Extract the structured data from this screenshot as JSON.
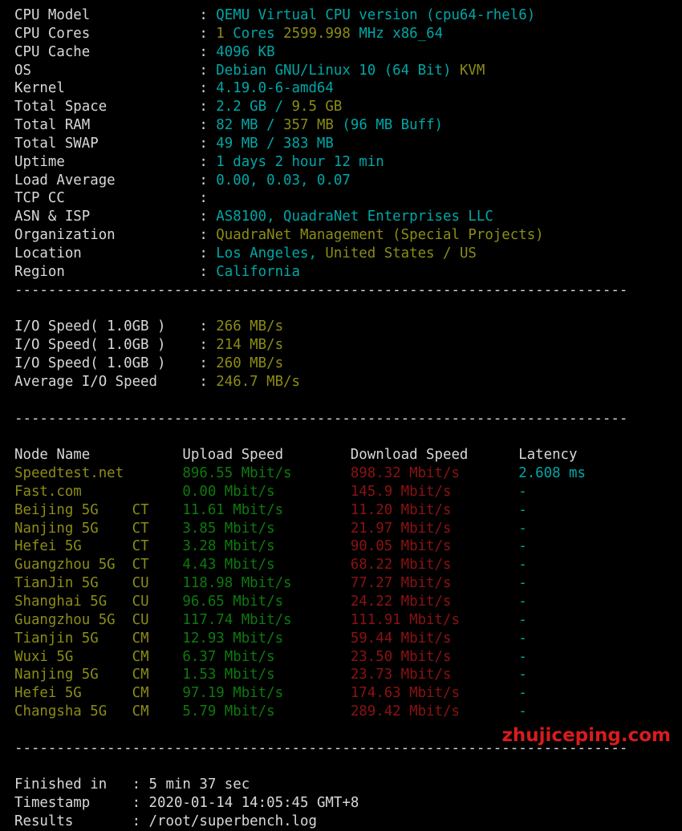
{
  "terminal": {
    "background_color": "#000000",
    "label_color": "#d8d8d8",
    "cyan": "#00a7a7",
    "olive": "#8c8c16",
    "green": "#0d7a0d",
    "red": "#8c1212",
    "watermark_color": "#d81c1c"
  },
  "separator": "-------------------------------------------------------------------------",
  "sysinfo": {
    "rows": [
      {
        "label": "CPU Model",
        "sep": ":",
        "parts": [
          {
            "t": "QEMU Virtual CPU version (cpu64-rhel6)",
            "c": "cy"
          }
        ]
      },
      {
        "label": "CPU Cores",
        "sep": ":",
        "parts": [
          {
            "t": "1",
            "c": "ye"
          },
          {
            "t": " ",
            "c": "w"
          },
          {
            "t": "Cores",
            "c": "cy"
          },
          {
            "t": " ",
            "c": "w"
          },
          {
            "t": "2599.998",
            "c": "ye"
          },
          {
            "t": " ",
            "c": "w"
          },
          {
            "t": "MHz x86_64",
            "c": "cy"
          }
        ]
      },
      {
        "label": "CPU Cache",
        "sep": ":",
        "parts": [
          {
            "t": "4096 KB",
            "c": "cy"
          }
        ]
      },
      {
        "label": "OS",
        "sep": ":",
        "parts": [
          {
            "t": "Debian GNU/Linux 10 (64 Bit)",
            "c": "cy"
          },
          {
            "t": " ",
            "c": "w"
          },
          {
            "t": "KVM",
            "c": "ye"
          }
        ]
      },
      {
        "label": "Kernel",
        "sep": ":",
        "parts": [
          {
            "t": "4.19.0-6-amd64",
            "c": "cy"
          }
        ]
      },
      {
        "label": "Total Space",
        "sep": ":",
        "parts": [
          {
            "t": "2.2 GB",
            "c": "cy"
          },
          {
            "t": " / ",
            "c": "cy"
          },
          {
            "t": "9.5 GB",
            "c": "ye"
          }
        ]
      },
      {
        "label": "Total RAM",
        "sep": ":",
        "parts": [
          {
            "t": "82 MB",
            "c": "cy"
          },
          {
            "t": " / ",
            "c": "cy"
          },
          {
            "t": "357 MB",
            "c": "ye"
          },
          {
            "t": " ",
            "c": "w"
          },
          {
            "t": "(96 MB Buff)",
            "c": "cy"
          }
        ]
      },
      {
        "label": "Total SWAP",
        "sep": ":",
        "parts": [
          {
            "t": "49 MB / 383 MB",
            "c": "cy"
          }
        ]
      },
      {
        "label": "Uptime",
        "sep": ":",
        "parts": [
          {
            "t": "1 days 2 hour 12 min",
            "c": "cy"
          }
        ]
      },
      {
        "label": "Load Average",
        "sep": ":",
        "parts": [
          {
            "t": "0.00, 0.03, 0.07",
            "c": "cy"
          }
        ]
      },
      {
        "label": "TCP CC",
        "sep": ":",
        "parts": [
          {
            "t": "",
            "c": "cy"
          }
        ]
      },
      {
        "label": "ASN & ISP",
        "sep": ":",
        "parts": [
          {
            "t": "AS8100, QuadraNet Enterprises LLC",
            "c": "cy"
          }
        ]
      },
      {
        "label": "Organization",
        "sep": ":",
        "parts": [
          {
            "t": "QuadraNet Management (Special Projects)",
            "c": "ye"
          }
        ]
      },
      {
        "label": "Location",
        "sep": ":",
        "parts": [
          {
            "t": "Los Angeles,",
            "c": "cy"
          },
          {
            "t": " ",
            "c": "w"
          },
          {
            "t": "United States / US",
            "c": "ye"
          }
        ]
      },
      {
        "label": "Region",
        "sep": ":",
        "parts": [
          {
            "t": "California",
            "c": "cy"
          }
        ]
      }
    ]
  },
  "iospeed": {
    "rows": [
      {
        "label": "I/O Speed( 1.0GB )",
        "sep": ":",
        "value": "266 MB/s",
        "c": "ye"
      },
      {
        "label": "I/O Speed( 1.0GB )",
        "sep": ":",
        "value": "214 MB/s",
        "c": "ye"
      },
      {
        "label": "I/O Speed( 1.0GB )",
        "sep": ":",
        "value": "260 MB/s",
        "c": "ye"
      },
      {
        "label": "Average I/O Speed",
        "sep": ":",
        "value": "246.7 MB/s",
        "c": "ye"
      }
    ]
  },
  "speedtest": {
    "headers": [
      "Node Name",
      "Upload Speed",
      "Download Speed",
      "Latency"
    ],
    "rows": [
      {
        "node": "Speedtest.net",
        "isp": "",
        "upload": "896.55 Mbit/s",
        "download": "898.32 Mbit/s",
        "latency": "2.608 ms"
      },
      {
        "node": "Fast.com",
        "isp": "",
        "upload": "0.00 Mbit/s",
        "download": "145.9 Mbit/s",
        "latency": "-"
      },
      {
        "node": "Beijing 5G",
        "isp": "CT",
        "upload": "11.61 Mbit/s",
        "download": "11.20 Mbit/s",
        "latency": "-"
      },
      {
        "node": "Nanjing 5G",
        "isp": "CT",
        "upload": "3.85 Mbit/s",
        "download": "21.97 Mbit/s",
        "latency": "-"
      },
      {
        "node": "Hefei 5G",
        "isp": "CT",
        "upload": "3.28 Mbit/s",
        "download": "90.05 Mbit/s",
        "latency": "-"
      },
      {
        "node": "Guangzhou 5G",
        "isp": "CT",
        "upload": "4.43 Mbit/s",
        "download": "68.22 Mbit/s",
        "latency": "-"
      },
      {
        "node": "TianJin 5G",
        "isp": "CU",
        "upload": "118.98 Mbit/s",
        "download": "77.27 Mbit/s",
        "latency": "-"
      },
      {
        "node": "Shanghai 5G",
        "isp": "CU",
        "upload": "96.65 Mbit/s",
        "download": "24.22 Mbit/s",
        "latency": "-"
      },
      {
        "node": "Guangzhou 5G",
        "isp": "CU",
        "upload": "117.74 Mbit/s",
        "download": "111.91 Mbit/s",
        "latency": "-"
      },
      {
        "node": "Tianjin 5G",
        "isp": "CM",
        "upload": "12.93 Mbit/s",
        "download": "59.44 Mbit/s",
        "latency": "-"
      },
      {
        "node": "Wuxi 5G",
        "isp": "CM",
        "upload": "6.37 Mbit/s",
        "download": "23.50 Mbit/s",
        "latency": "-"
      },
      {
        "node": "Nanjing 5G",
        "isp": "CM",
        "upload": "1.53 Mbit/s",
        "download": "23.73 Mbit/s",
        "latency": "-"
      },
      {
        "node": "Hefei 5G",
        "isp": "CM",
        "upload": "97.19 Mbit/s",
        "download": "174.63 Mbit/s",
        "latency": "-"
      },
      {
        "node": "Changsha 5G",
        "isp": "CM",
        "upload": "5.79 Mbit/s",
        "download": "289.42 Mbit/s",
        "latency": "-"
      }
    ]
  },
  "footer": {
    "rows": [
      {
        "label": "Finished in",
        "sep": ":",
        "value": "5 min 37 sec"
      },
      {
        "label": "Timestamp",
        "sep": ":",
        "value": "2020-01-14 14:05:45 GMT+8"
      },
      {
        "label": "Results",
        "sep": ":",
        "value": "/root/superbench.log"
      }
    ]
  },
  "watermark": {
    "text": "zhujiceping.com"
  }
}
